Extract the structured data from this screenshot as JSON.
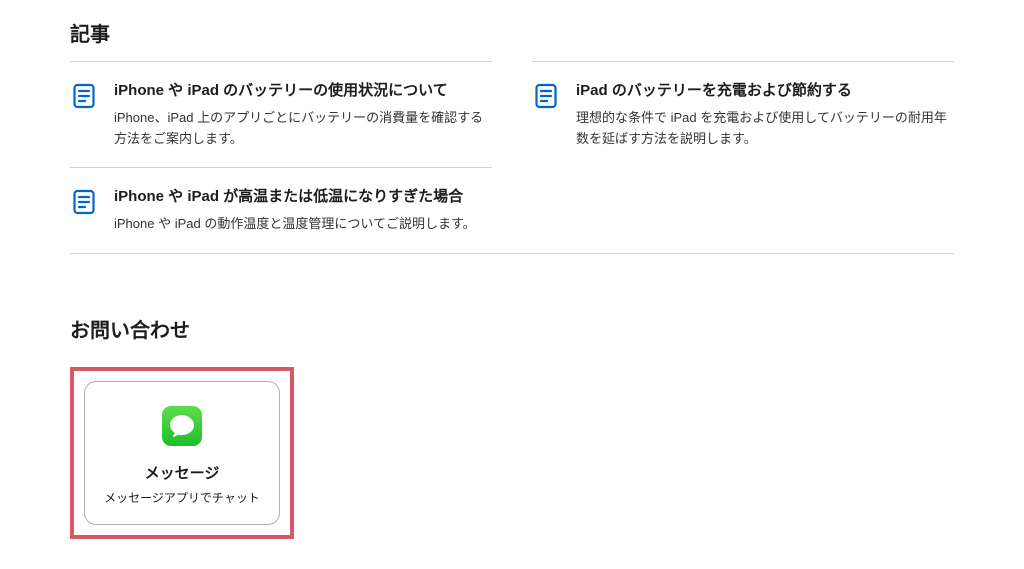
{
  "articles": {
    "heading": "記事",
    "items": [
      {
        "title": "iPhone や iPad のバッテリーの使用状況について",
        "desc": "iPhone、iPad 上のアプリごとにバッテリーの消費量を確認する方法をご案内します。"
      },
      {
        "title": "iPad のバッテリーを充電および節約する",
        "desc": "理想的な条件で iPad を充電および使用してバッテリーの耐用年数を延ばす方法を説明します。"
      },
      {
        "title": "iPhone や iPad が高温または低温になりすぎた場合",
        "desc": "iPhone や iPad の動作温度と温度管理についてご説明します。"
      }
    ]
  },
  "contact": {
    "heading": "お問い合わせ",
    "card": {
      "title": "メッセージ",
      "sub": "メッセージアプリでチャット"
    }
  },
  "colors": {
    "link_blue": "#0066cc",
    "highlight": "#d65a63",
    "messages_green_top": "#5dde4a",
    "messages_green_bot": "#1bbf2a"
  }
}
